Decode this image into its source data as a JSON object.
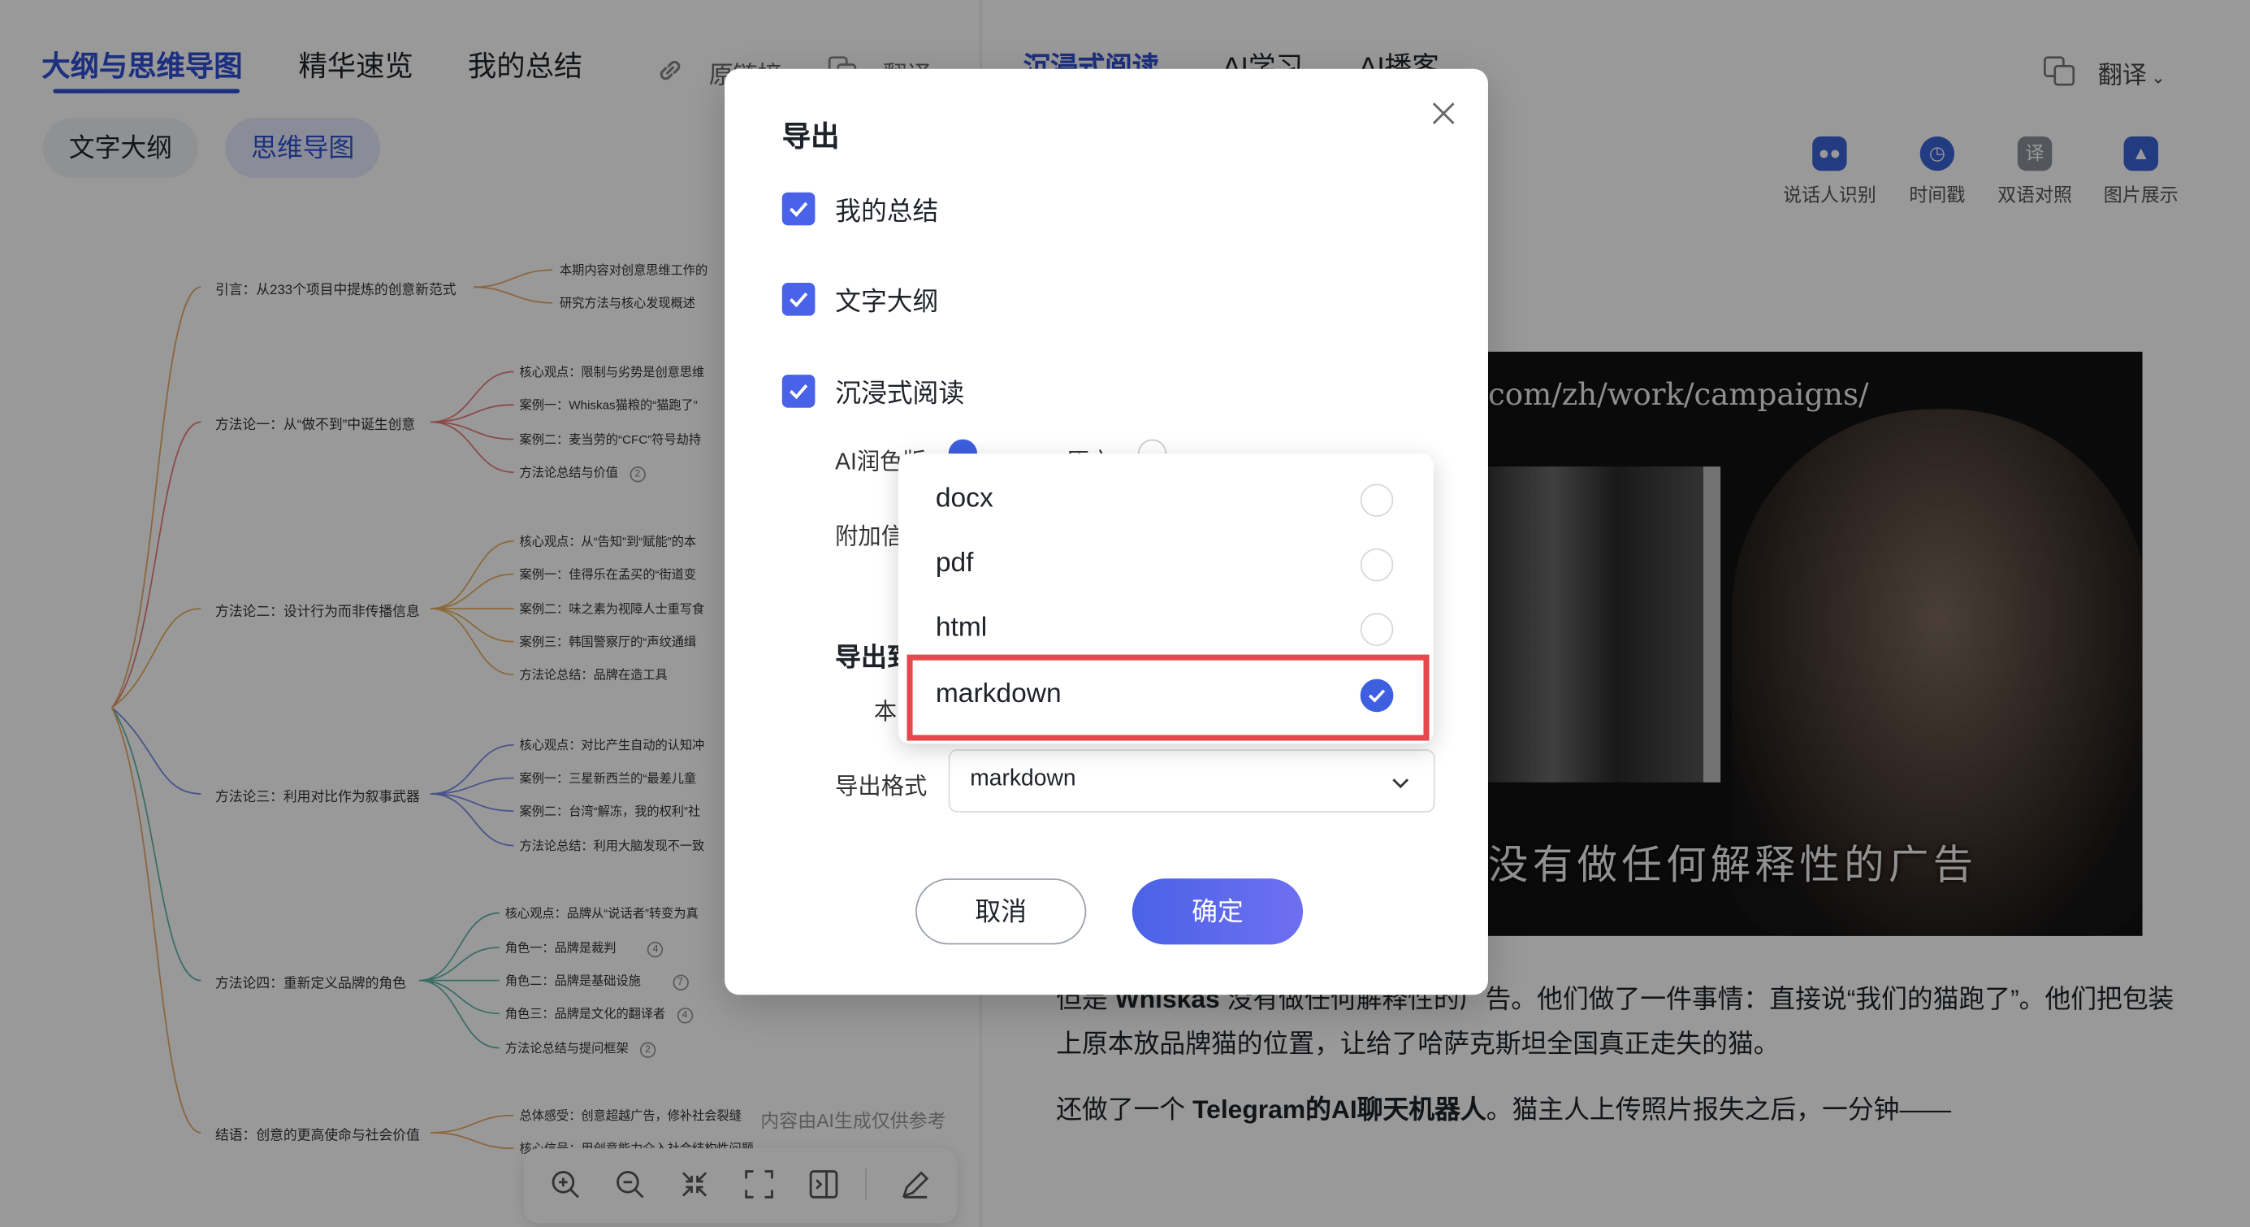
{
  "left_header": {
    "tabs": [
      "大纲与思维导图",
      "精华速览",
      "我的总结"
    ],
    "links": [
      "原链接",
      "翻译"
    ],
    "subtabs": [
      "文字大纲",
      "思维导图"
    ]
  },
  "mindmap": {
    "branches": [
      {
        "title": "引言：从233个项目中提炼的创意新范式",
        "items": [
          "本期内容对创意思维工作的",
          "研究方法与核心发现概述"
        ]
      },
      {
        "title": "方法论一：从“做不到”中诞生创意",
        "items": [
          "核心观点：限制与劣势是创意思维",
          "案例一：Whiskas猫粮的“猫跑了”",
          "案例二：麦当劳的“CFC”符号劫持",
          "方法论总结与价值"
        ],
        "count": "2"
      },
      {
        "title": "方法论二：设计行为而非传播信息",
        "items": [
          "核心观点：从“告知”到“赋能”的本",
          "案例一：佳得乐在孟买的“街道变",
          "案例二：味之素为视障人士重写食",
          "案例三：韩国警察厅的“声纹通缉",
          "方法论总结：品牌在造工具"
        ]
      },
      {
        "title": "方法论三：利用对比作为叙事武器",
        "items": [
          "核心观点：对比产生自动的认知冲",
          "案例一：三星新西兰的“最差儿童",
          "案例二：台湾“解冻，我的权利”社",
          "方法论总结：利用大脑发现不一致"
        ]
      },
      {
        "title": "方法论四：重新定义品牌的角色",
        "items": [
          "核心观点：品牌从“说话者”转变为真",
          "角色一：品牌是裁判",
          "角色二：品牌是基础设施",
          "角色三：品牌是文化的翻译者",
          "方法论总结与提问框架"
        ],
        "counts": [
          "4",
          "7",
          "4",
          "2"
        ]
      },
      {
        "title": "结语：创意的更高使命与社会价值",
        "items": [
          "总体感受：创意超越广告，修补社会裂缝",
          "核心信号：用创意能力介入社会结构性问题"
        ]
      }
    ],
    "ai_note": "内容由AI生成仅供参考"
  },
  "right_header": {
    "tabs": [
      "沉浸式阅读",
      "AI学习",
      "AI播客"
    ],
    "translate": "翻译",
    "tools": [
      {
        "label": "说话人识别",
        "icon": "people-icon"
      },
      {
        "label": "时间戳",
        "icon": "clock-icon"
      },
      {
        "label": "双语对照",
        "icon": "translate-icon"
      },
      {
        "label": "图片展示",
        "icon": "image-icon"
      }
    ]
  },
  "video": {
    "url_text": "com/zh/work/campaigns/",
    "subtitle": "没有做任何解释性的广告"
  },
  "article": {
    "line1a": "但是 ",
    "line1b": "Whiskas",
    "line1c": " 没有做任何解释性的广告。他们做了一件事情：直接说“我们的猫跑了”。他们把包装",
    "line2": "上原本放品牌猫的位置，让给了哈萨克斯坦全国真正走失的猫。",
    "line3a": "还做了一个 ",
    "line3b": "Telegram的AI聊天机器人",
    "line3c": "。猫主人上传照片报失之后，一分钟——"
  },
  "modal": {
    "title": "导出",
    "checkboxes": [
      "我的总结",
      "文字大纲",
      "沉浸式阅读"
    ],
    "ai_polish_label": "AI润色版",
    "original_label": "原文",
    "attach_label": "附加信",
    "export_to_label": "导出到",
    "local_label": "本",
    "format_label": "导出格式",
    "format_value": "markdown",
    "cancel": "取消",
    "confirm": "确定"
  },
  "dropdown": {
    "options": [
      "docx",
      "pdf",
      "html",
      "markdown"
    ],
    "selected": "markdown"
  },
  "colors": {
    "accent": "#4a62e8",
    "tab_active": "#3150d4",
    "highlight": "#e5484d"
  }
}
